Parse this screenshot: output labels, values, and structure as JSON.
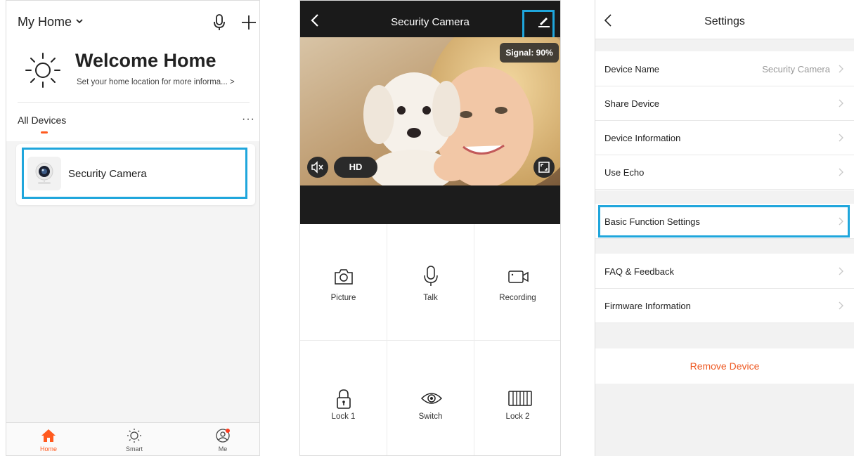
{
  "colors": {
    "accent": "#ff5a1f",
    "highlight": "#1fa6dc",
    "remove": "#ee5a24"
  },
  "home": {
    "home_name": "My Home",
    "welcome_title": "Welcome Home",
    "welcome_subtitle": "Set your home location for more informa...  >",
    "section_title": "All Devices",
    "more_label": "···",
    "device": {
      "name": "Security Camera",
      "icon": "security-camera-icon"
    },
    "tabs": [
      {
        "label": "Home",
        "icon": "home-icon",
        "active": true
      },
      {
        "label": "Smart",
        "icon": "sun-icon",
        "active": false
      },
      {
        "label": "Me",
        "icon": "profile-icon",
        "active": false
      }
    ]
  },
  "camera": {
    "title": "Security Camera",
    "signal": "Signal: 90%",
    "quality": "HD",
    "controls": [
      {
        "label": "Picture",
        "icon": "camera-icon"
      },
      {
        "label": "Talk",
        "icon": "microphone-icon"
      },
      {
        "label": "Recording",
        "icon": "video-icon"
      },
      {
        "label": "Lock 1",
        "icon": "lock-icon"
      },
      {
        "label": "Switch",
        "icon": "eye-icon"
      },
      {
        "label": "Lock 2",
        "icon": "gate-icon"
      }
    ]
  },
  "settings": {
    "title": "Settings",
    "rows": [
      {
        "label": "Device Name",
        "value": "Security Camera"
      },
      {
        "label": "Share Device",
        "value": ""
      },
      {
        "label": "Device Information",
        "value": ""
      },
      {
        "label": "Use Echo",
        "value": ""
      },
      {
        "label": "Basic Function Settings",
        "value": ""
      },
      {
        "label": "FAQ & Feedback",
        "value": ""
      },
      {
        "label": "Firmware Information",
        "value": ""
      }
    ],
    "remove_label": "Remove Device"
  }
}
